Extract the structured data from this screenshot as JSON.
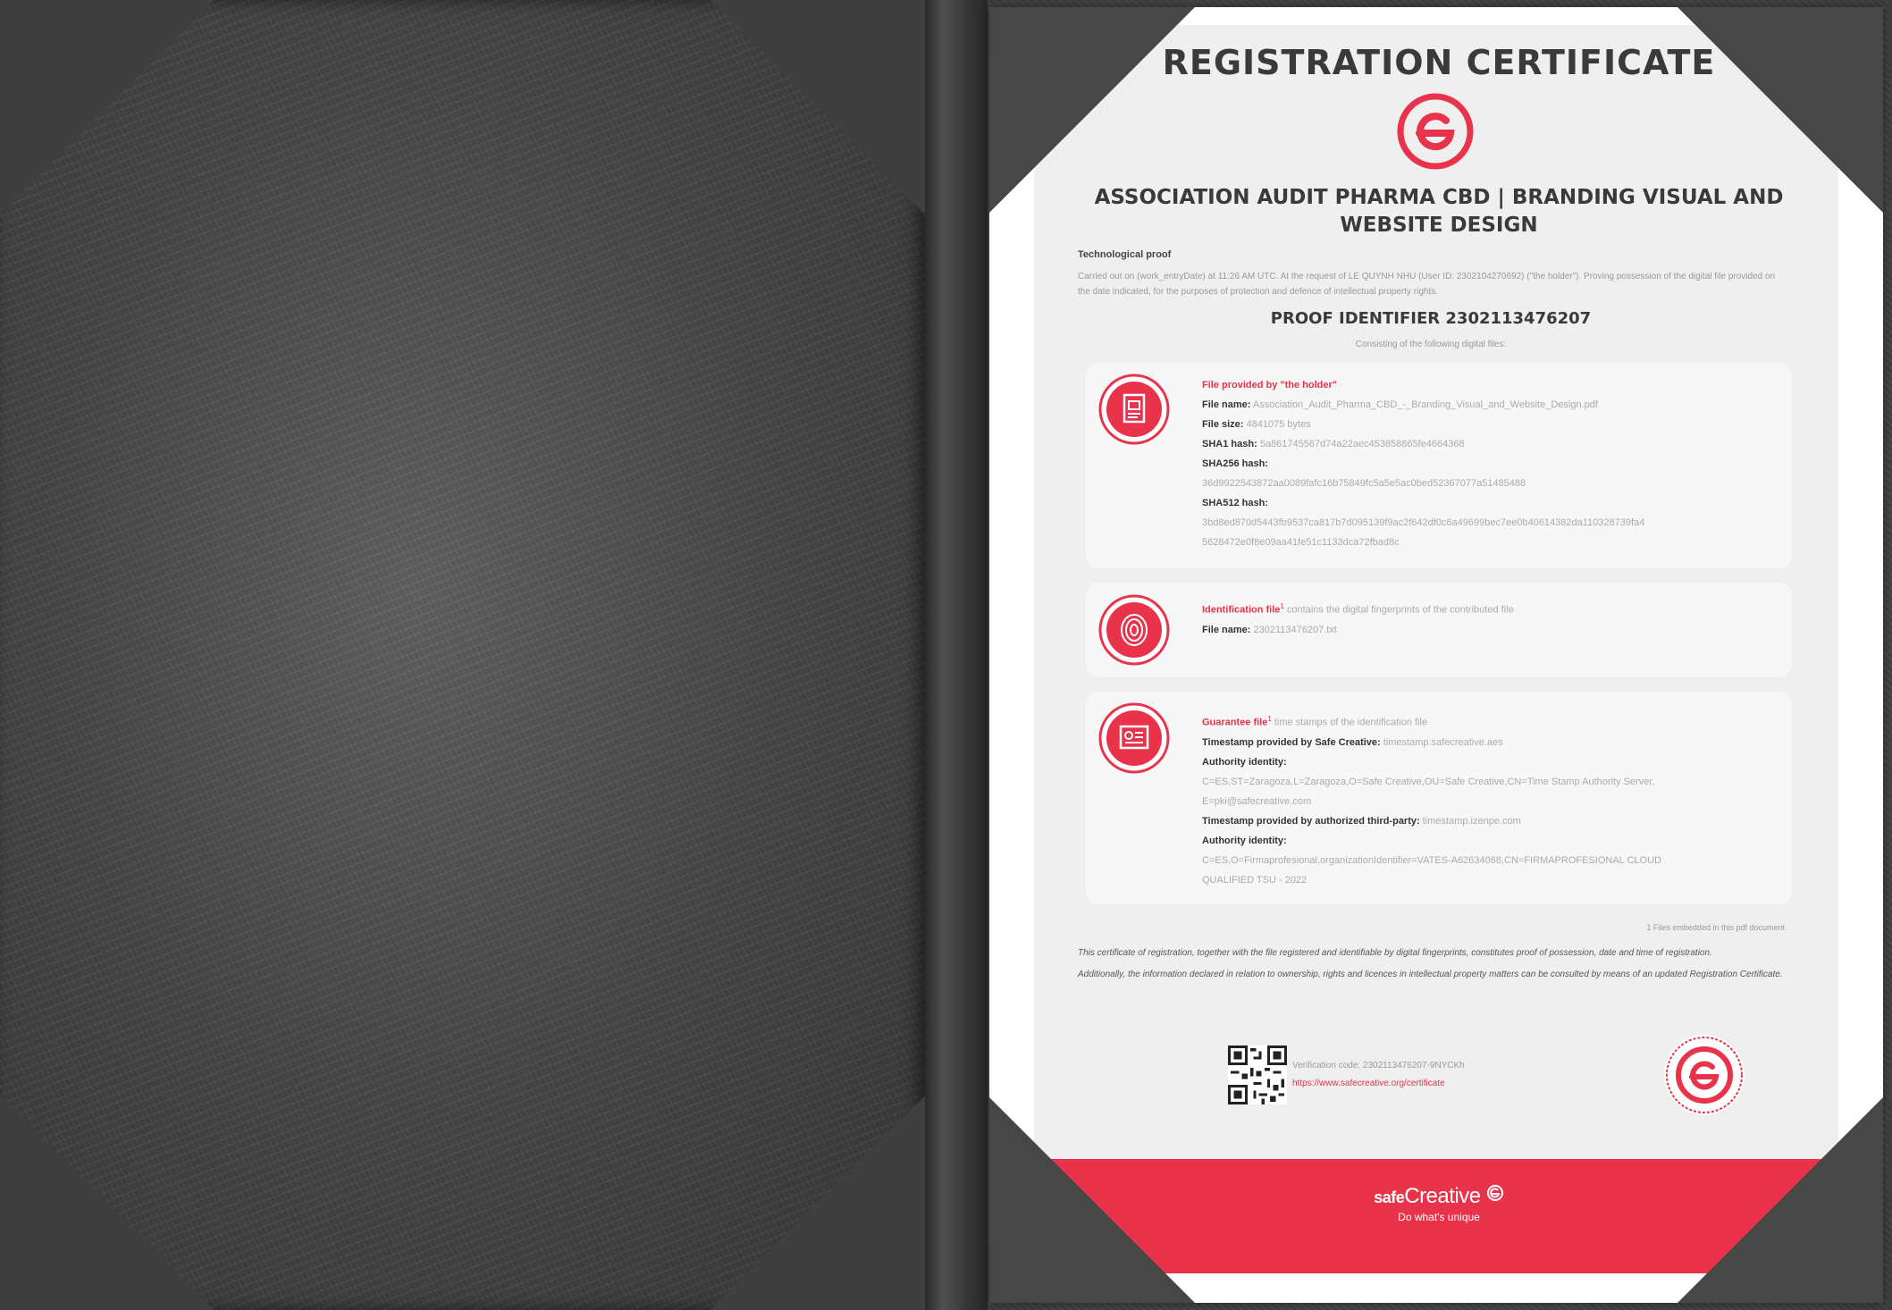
{
  "certificate": {
    "title": "REGISTRATION CERTIFICATE",
    "work_title": "ASSOCIATION AUDIT PHARMA CBD | BRANDING VISUAL AND WEBSITE DESIGN",
    "tech_label": "Technological proof",
    "tech_text": "Carried out on (work_entryDate) at 11:26 AM UTC. At the request of LE QUYNH NHU (User ID: 2302104270692) (\"the holder\"). Proving possession of the digital file provided on the date indicated, for the purposes of protection and defence of intellectual property rights.",
    "proof_identifier": "PROOF IDENTIFIER 2302113476207",
    "proof_sub": "Consisting of the following digital files:"
  },
  "file_box": {
    "heading": "File provided by \"the holder\"",
    "name_label": "File name:",
    "name_value": "Association_Audit_Pharma_CBD_-_Branding_Visual_and_Website_Design.pdf",
    "size_label": "File size:",
    "size_value": "4841075 bytes",
    "sha1_label": "SHA1 hash:",
    "sha1_value": "5a861745567d74a22aec453858865fe4664368",
    "sha256_label": "SHA256 hash:",
    "sha256_value": "36d9922543872aa0089fafc16b75849fc5a5e5ac0bed52367077a51485488",
    "sha512_label": "SHA512 hash:",
    "sha512_line1": "3bd8ed870d5443fb9537ca817b7d095139f9ac2f642df0c6a49699bec7ee0b40614382da110328739fa4",
    "sha512_line2": "5628472e0f8e09aa41fe51c1133dca72fbad8c"
  },
  "ident_box": {
    "heading": "Identification file",
    "sup": "1",
    "desc": "contains the digital fingerprints of the contributed file",
    "name_label": "File name:",
    "name_value": "2302113476207.txt"
  },
  "guarantee_box": {
    "heading": "Guarantee file",
    "sup": "1",
    "desc": "time stamps of the identification file",
    "ts_safe_label": "Timestamp provided by Safe Creative:",
    "ts_safe_value": "timestamp.safecreative.aes",
    "authority_label": "Authority identity:",
    "authority_safe_line1": "C=ES,ST=Zaragoza,L=Zaragoza,O=Safe Creative,OU=Safe Creative,CN=Time Stamp Authority Server,",
    "authority_safe_line2": "E=pki@safecreative.com",
    "ts_third_label": "Timestamp provided by authorized third-party:",
    "ts_third_value": "timestamp.izenpe.com",
    "authority_third_label": "Authority identity:",
    "authority_third_line1": "C=ES,O=Firmaprofesional,organizationIdentifier=VATES-A62634068,CN=FIRMAPROFESIONAL CLOUD",
    "authority_third_line2": "QUALIFIED TSU - 2022"
  },
  "footnote": "1 Files embedded in this pdf document",
  "legal": {
    "p1": "This certificate of registration, together with the file registered and identifiable by digital fingerprints, constitutes proof of possession, date and time of registration.",
    "p2": "Additionally, the information declared in relation to ownership, rights and licences in intellectual property matters can be consulted by means of an updated Registration Certificate."
  },
  "verification": {
    "code": "Verification code: 2302113476207-9NYCKh",
    "url": "https://www.safecreative.org/certificate"
  },
  "brand": {
    "safe": "safe",
    "creative": "Creative",
    "tagline": "Do what's unique"
  },
  "colors": {
    "accent": "#e8334a",
    "dark_text": "#3a3a3a"
  }
}
